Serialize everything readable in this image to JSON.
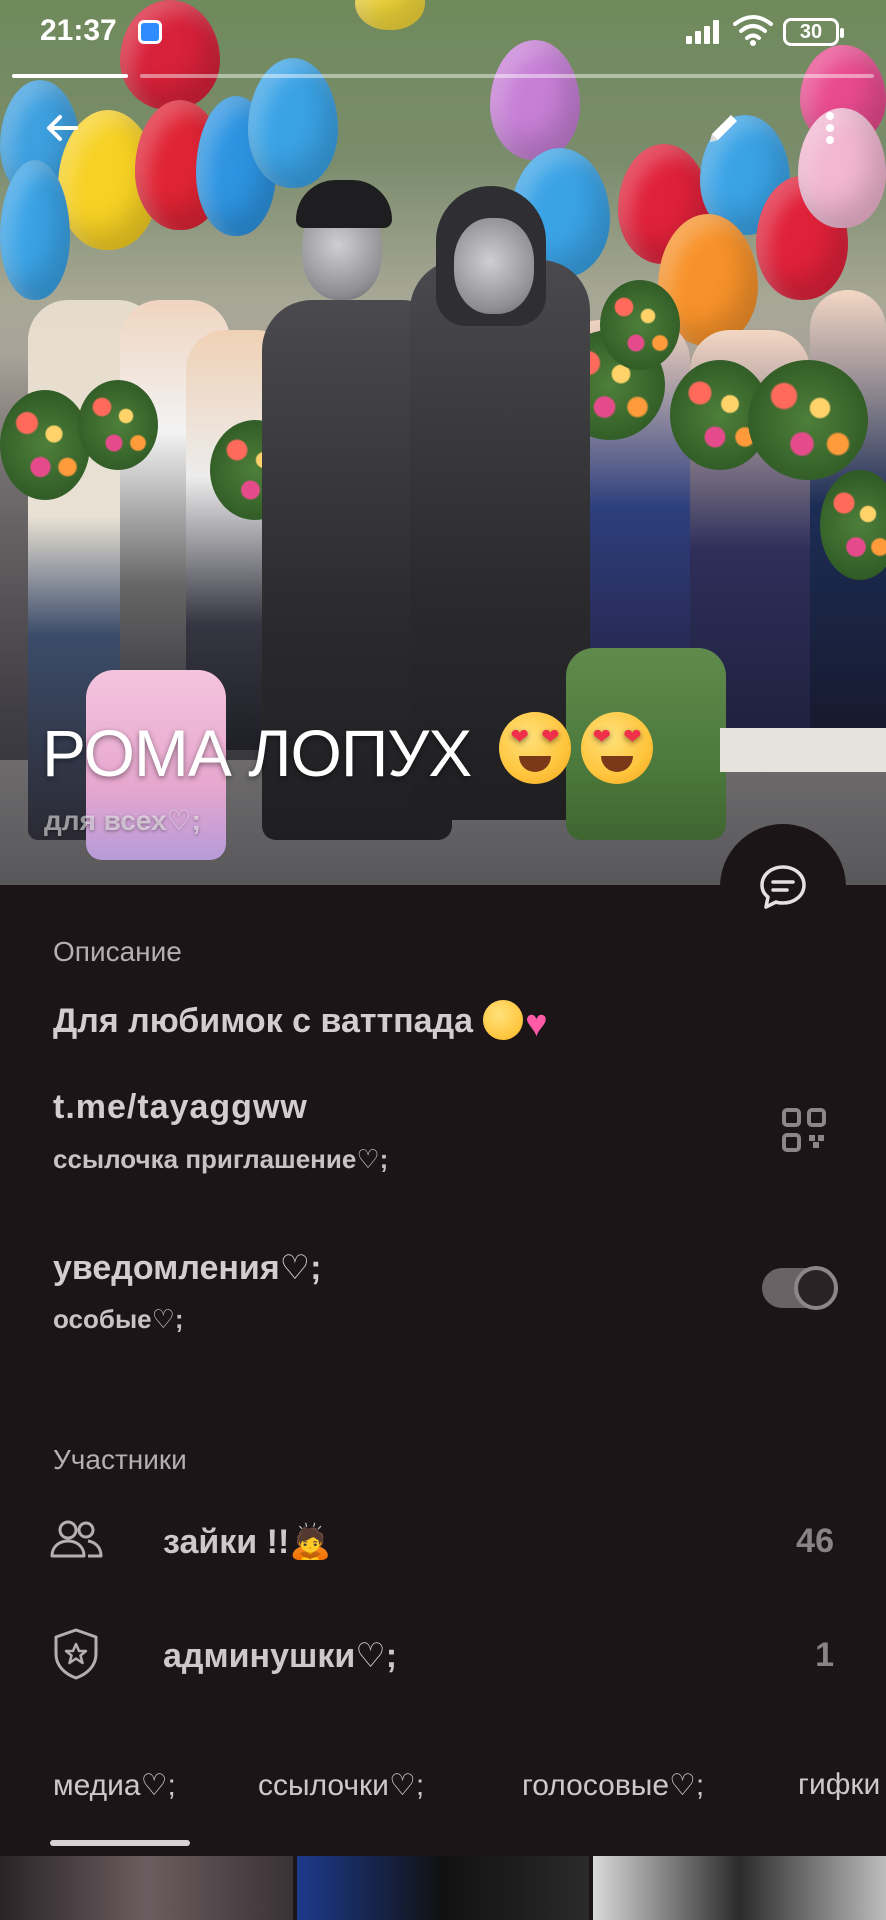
{
  "status_bar": {
    "time": "21:37",
    "battery": "30"
  },
  "group": {
    "title": "РОМА ЛОПУХ",
    "subtitle": "для всех♡;"
  },
  "description": {
    "label": "Описание",
    "text": "Для любимок с ваттпада"
  },
  "invite": {
    "link": "t.me/tayaggww",
    "caption": "ссылочка приглашение♡;"
  },
  "notifications": {
    "title": "уведомления♡;",
    "caption": "особые♡;",
    "enabled": true
  },
  "members": {
    "label": "Участники",
    "rows": [
      {
        "label": "зайки !!🙇",
        "count": "46",
        "icon": "people-icon"
      },
      {
        "label": "админушки♡;",
        "count": "1",
        "icon": "shield-star-icon"
      }
    ]
  },
  "tabs": [
    {
      "label": "медиа♡;",
      "active": true
    },
    {
      "label": "ссылочки♡;",
      "active": false
    },
    {
      "label": "голосовые♡;",
      "active": false
    },
    {
      "label": "гифки",
      "active": false
    }
  ],
  "colors": {
    "background": "#1c1518",
    "text_primary": "#d4cdd0",
    "text_muted": "#8a8386",
    "accent_heart": "#ff5aa6"
  }
}
